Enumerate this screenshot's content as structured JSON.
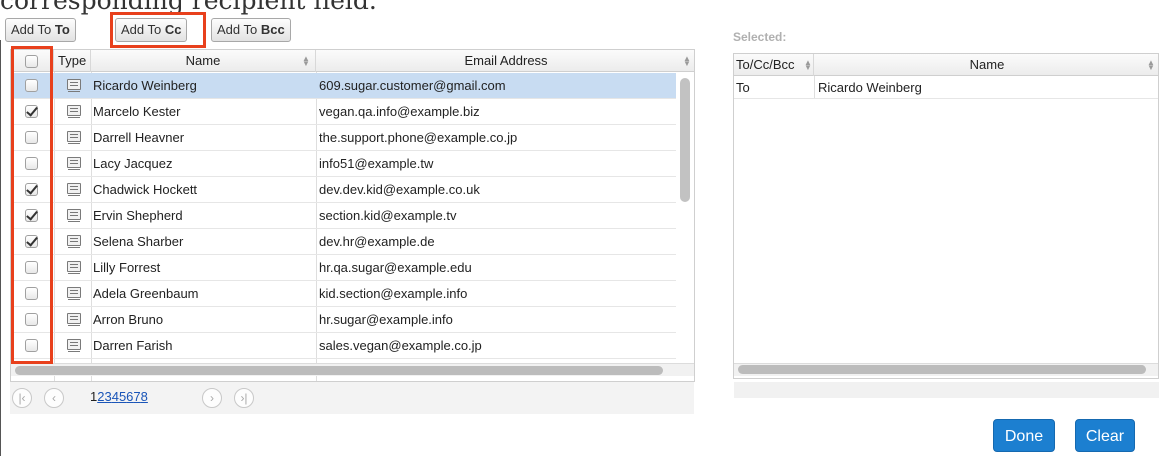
{
  "top_text": "corresponding recipient field.",
  "toolbar": {
    "add_to_to": {
      "prefix": "Add To ",
      "bold": "To"
    },
    "add_to_cc": {
      "prefix": "Add To ",
      "bold": "Cc"
    },
    "add_to_bcc": {
      "prefix": "Add To ",
      "bold": "Bcc"
    }
  },
  "contacts_table": {
    "headers": {
      "type": "Type",
      "name": "Name",
      "email": "Email Address"
    },
    "rows": [
      {
        "checked": false,
        "name": "Ricardo Weinberg",
        "email": "609.sugar.customer@gmail.com",
        "selected": true
      },
      {
        "checked": true,
        "name": "Marcelo Kester",
        "email": "vegan.qa.info@example.biz",
        "selected": false
      },
      {
        "checked": false,
        "name": "Darrell Heavner",
        "email": "the.support.phone@example.co.jp",
        "selected": false
      },
      {
        "checked": false,
        "name": "Lacy Jacquez",
        "email": "info51@example.tw",
        "selected": false
      },
      {
        "checked": true,
        "name": "Chadwick Hockett",
        "email": "dev.dev.kid@example.co.uk",
        "selected": false
      },
      {
        "checked": true,
        "name": "Ervin Shepherd",
        "email": "section.kid@example.tv",
        "selected": false
      },
      {
        "checked": true,
        "name": "Selena Sharber",
        "email": "dev.hr@example.de",
        "selected": false
      },
      {
        "checked": false,
        "name": "Lilly Forrest",
        "email": "hr.qa.sugar@example.edu",
        "selected": false
      },
      {
        "checked": false,
        "name": "Adela Greenbaum",
        "email": "kid.section@example.info",
        "selected": false
      },
      {
        "checked": false,
        "name": "Arron Bruno",
        "email": "hr.sugar@example.info",
        "selected": false
      },
      {
        "checked": false,
        "name": "Darren Farish",
        "email": "sales.vegan@example.co.jp",
        "selected": false
      }
    ]
  },
  "pager": {
    "first": "|‹",
    "prev": "‹",
    "current_page": "1",
    "pages": [
      "2",
      "3",
      "4",
      "5",
      "6",
      "7",
      "8"
    ],
    "next": "›",
    "last": "›|"
  },
  "selected_panel": {
    "label": "Selected:",
    "headers": {
      "field": "To/Cc/Bcc",
      "name": "Name"
    },
    "rows": [
      {
        "field": "To",
        "name": "Ricardo Weinberg"
      }
    ]
  },
  "buttons": {
    "done": "Done",
    "clear": "Clear"
  },
  "colors": {
    "highlight": "#e8401c",
    "primary": "#1c7fd0",
    "row_selected": "#c8dcf2",
    "link": "#1a55b8"
  },
  "icons": {
    "type": "address-book-icon",
    "sort": "sort-icon"
  }
}
